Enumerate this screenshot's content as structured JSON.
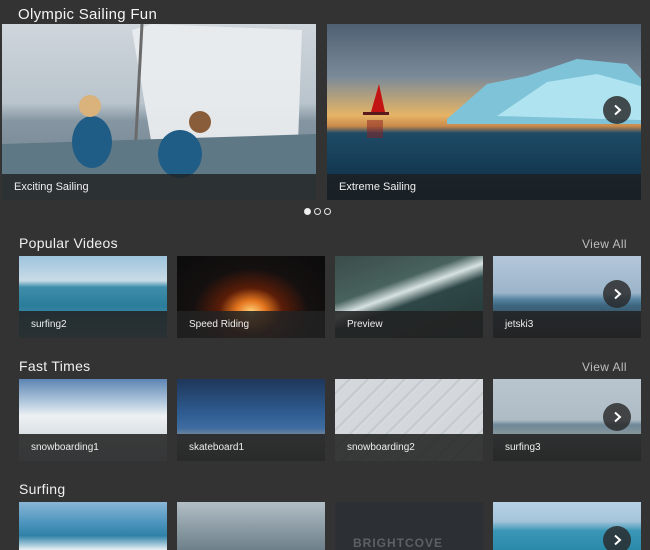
{
  "hero": {
    "title": "Olympic Sailing Fun",
    "slides": [
      {
        "caption": "Exciting Sailing"
      },
      {
        "caption": "Extreme Sailing"
      }
    ],
    "dots": 3,
    "active_dot": 0
  },
  "sections": [
    {
      "title": "Popular Videos",
      "view_all": "View All",
      "items": [
        {
          "caption": "surfing2"
        },
        {
          "caption": "Speed Riding"
        },
        {
          "caption": "Preview"
        },
        {
          "caption": "jetski3"
        }
      ]
    },
    {
      "title": "Fast Times",
      "view_all": "View All",
      "items": [
        {
          "caption": "snowboarding1"
        },
        {
          "caption": "skateboard1"
        },
        {
          "caption": "snowboarding2"
        },
        {
          "caption": "surfing3"
        }
      ]
    },
    {
      "title": "Surfing",
      "items": [
        {
          "caption": ""
        },
        {
          "caption": ""
        },
        {
          "caption": "",
          "watermark": "BRIGHTCOVE BEACON"
        },
        {
          "caption": ""
        }
      ]
    }
  ],
  "icons": {
    "next": "chevron-right-icon"
  }
}
